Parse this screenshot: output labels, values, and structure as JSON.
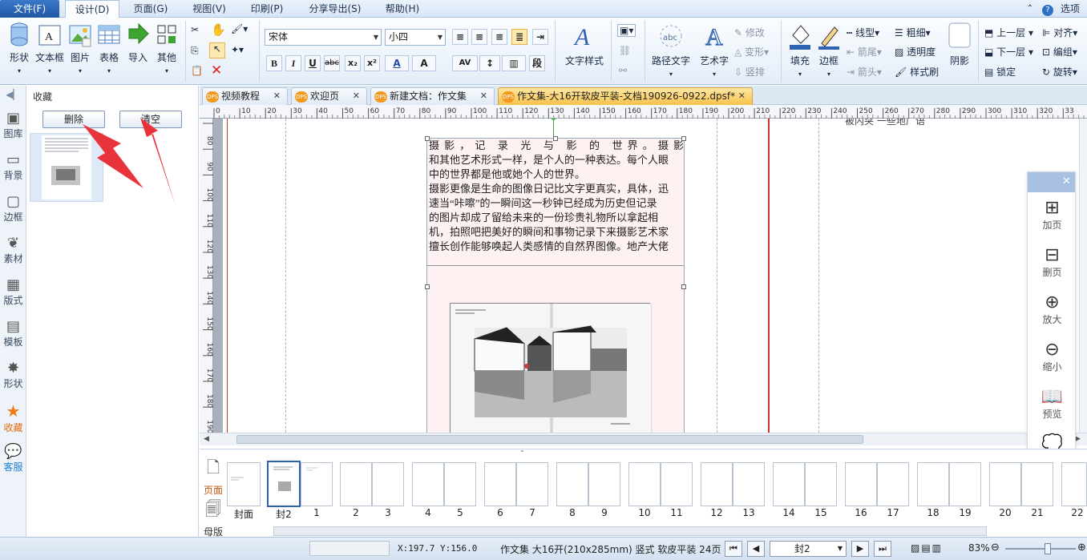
{
  "menu": {
    "file": "文件(F)",
    "tabs": [
      "设计(D)",
      "页面(G)",
      "视图(V)",
      "印刷(P)",
      "分享导出(S)",
      "帮助(H)"
    ],
    "options": "选项"
  },
  "ribbon": {
    "insert": [
      "形状",
      "文本框",
      "图片",
      "表格",
      "导入",
      "其他"
    ],
    "font_name": "宋体",
    "font_size": "小四",
    "text_style": "文字样式",
    "path_text": "路径文字",
    "art_text": "艺术字",
    "modify": "修改",
    "transform": "变形",
    "vertical": "竖排",
    "fill": "填充",
    "border": "边框",
    "line_type": "线型",
    "arrow_tail": "箭尾",
    "arrow_head": "箭头",
    "thickness": "粗细",
    "transparency": "透明度",
    "style_brush": "样式刷",
    "shadow": "阴影",
    "up_layer": "上一层",
    "down_layer": "下一层",
    "lock": "锁定",
    "align": "对齐",
    "group": "编组",
    "rotate": "旋转",
    "bold": "B",
    "italic": "I",
    "underline": "U",
    "strike": "abc",
    "sub": "x₂",
    "sup": "x²",
    "font_color": "A",
    "char_scale": "A",
    "char_space": "AV"
  },
  "leftbar": [
    "图库",
    "背景",
    "边框",
    "素材",
    "版式",
    "模板",
    "形状",
    "收藏",
    "客服"
  ],
  "panel": {
    "title": "收藏",
    "delete": "删除",
    "clear": "清空"
  },
  "doc_tabs": [
    {
      "label": "视频教程"
    },
    {
      "label": "欢迎页"
    },
    {
      "label": "新建文档：作文集"
    },
    {
      "label": "作文集-大16开软皮平装-文档190926-0922.dpsf*"
    }
  ],
  "tab_badge": "DPS",
  "ruler_h": [
    "0",
    "10",
    "20",
    "30",
    "40",
    "50",
    "60",
    "70",
    "80",
    "90",
    "100",
    "110",
    "120",
    "130",
    "140",
    "150",
    "160",
    "170",
    "180",
    "190",
    "200",
    "210",
    "220",
    "230",
    "240",
    "250",
    "260",
    "270",
    "280",
    "290",
    "300",
    "310",
    "320",
    "33"
  ],
  "ruler_v": [
    "80",
    "90",
    "100",
    "110",
    "120",
    "130",
    "140",
    "150",
    "160",
    "170",
    "180",
    "190"
  ],
  "doc_text": {
    "line1": "摄影，记 录 光 与 影 的 世界。摄影",
    "line2": "和其他艺术形式一样，是个人的一种表达。每个人眼",
    "line3": "中的世界都是他或她个人的世界。",
    "line4": "摄影更像是生命的图像日记比文字更真实，具体，迅",
    "line5": "速当“咔嚓”的一瞬间这一秒钟已经成为历史但记录",
    "line6": "的图片却成了留给未来的一份珍贵礼物所以拿起相",
    "line7": "机，拍照吧把美好的瞬间和事物记录下来摄影艺术家",
    "line8": "擅长创作能够唤起人类感情的自然界图像。地产大佬"
  },
  "right_page_text": "被内突 一些地广语",
  "float_panel": [
    "加页",
    "删页",
    "放大",
    "缩小",
    "预览",
    "分享"
  ],
  "pages": {
    "tab_page": "页面",
    "tab_master": "母版",
    "labels": [
      "封面",
      "封2",
      "1",
      "2",
      "3",
      "4",
      "5",
      "6",
      "7",
      "8",
      "9",
      "10",
      "11",
      "12",
      "13",
      "14",
      "15",
      "16",
      "17",
      "18",
      "19",
      "20",
      "21",
      "22"
    ]
  },
  "status": {
    "coords": "X:197.7  Y:156.0",
    "doc_info": "作文集 大16开(210x285mm) 竖式 软皮平装 24页",
    "current_page": "封2",
    "zoom": "83%",
    "zoom_level": 0.6
  },
  "colors": {
    "accent": "#1f56a3",
    "arrow": "#e8333a",
    "active_tab": "#f7c24a"
  }
}
